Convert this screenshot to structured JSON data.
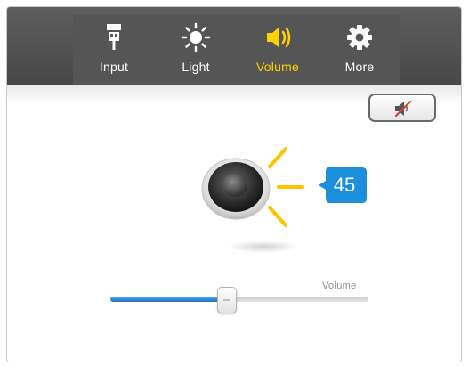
{
  "tabs": [
    {
      "label": "Input",
      "icon": "usb-plug-icon"
    },
    {
      "label": "Light",
      "icon": "sun-icon"
    },
    {
      "label": "Volume",
      "icon": "speaker-volume-icon"
    },
    {
      "label": "More",
      "icon": "gear-icon"
    }
  ],
  "active_tab": "Volume",
  "mute_button": {
    "icon": "speaker-muted-icon"
  },
  "volume": {
    "value": "45",
    "slider_label": "Volume",
    "level_percent": 45
  },
  "colors": {
    "accent": "#ffd200",
    "badge": "#1b8fdb",
    "slider_fill": "#2a7fcf",
    "topbar": "#505050"
  }
}
